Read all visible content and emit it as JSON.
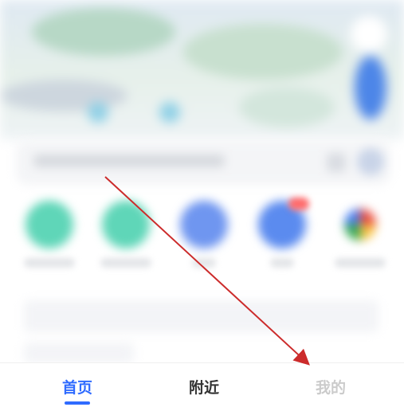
{
  "tabbar": {
    "tabs": [
      {
        "label": "首页",
        "active": true
      },
      {
        "label": "附近",
        "active": false
      },
      {
        "label": "我的",
        "active": false
      }
    ]
  },
  "colors": {
    "accent": "#2f6bff",
    "annotation_arrow": "#cc2b2b",
    "tab_inactive": "#333333",
    "shortcut_circles": [
      "#5fd6b8",
      "#5fd6b8",
      "#6f96f0",
      "#5b8bef"
    ]
  },
  "icons": {
    "shortcuts": [
      "teal-circle-icon",
      "teal-circle-icon",
      "blue-circle-icon",
      "blue-circle-icon",
      "colorful-grid-icon"
    ]
  }
}
